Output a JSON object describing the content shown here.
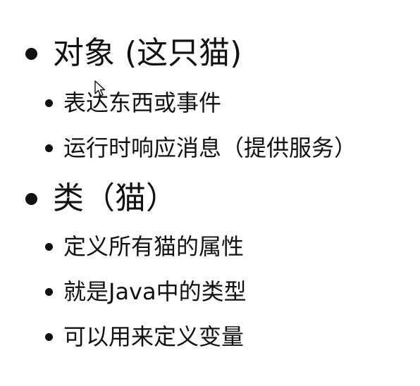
{
  "slide": {
    "items": [
      {
        "level": 1,
        "text": "对象  (这只猫)"
      },
      {
        "level": 2,
        "text": "表达东西或事件"
      },
      {
        "level": 2,
        "text": "运行时响应消息（提供服务）"
      },
      {
        "level": 1,
        "text": "类（猫）"
      },
      {
        "level": 2,
        "text": "定义所有猫的属性"
      },
      {
        "level": 2,
        "text": "就是Java中的类型"
      },
      {
        "level": 2,
        "text": "可以用来定义变量"
      }
    ]
  },
  "icons": {
    "cursor": "mouse-pointer-icon"
  }
}
